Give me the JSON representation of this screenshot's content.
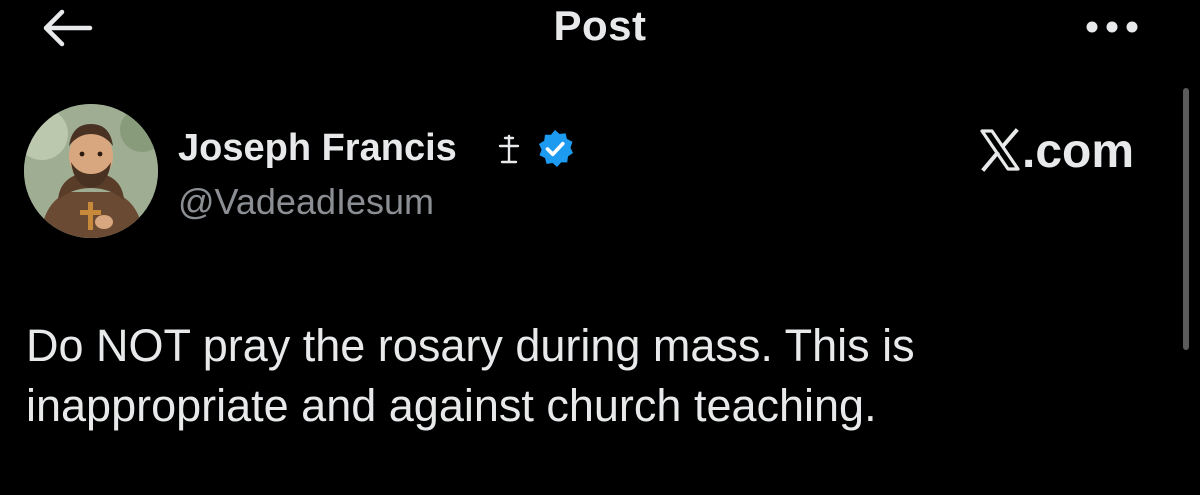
{
  "header": {
    "title": "Post",
    "back_icon": "arrow-left-icon",
    "more_icon": "more-horizontal-icon"
  },
  "post": {
    "author": {
      "display_name": "Joseph Francis",
      "name_emoji": "☩",
      "verified": true,
      "handle": "@VadeadIesum",
      "avatar_description_icon": "avatar-image"
    },
    "text_lines": [
      "Do NOT pray the rosary during mass. This is",
      "inappropriate and against church teaching."
    ]
  },
  "watermark": {
    "text": ".com",
    "logo_icon": "x-logo-icon"
  },
  "colors": {
    "background": "#000000",
    "primary_text": "#e7e9ea",
    "secondary_text": "#8b8f94",
    "verified_blue": "#1d9bf0"
  }
}
